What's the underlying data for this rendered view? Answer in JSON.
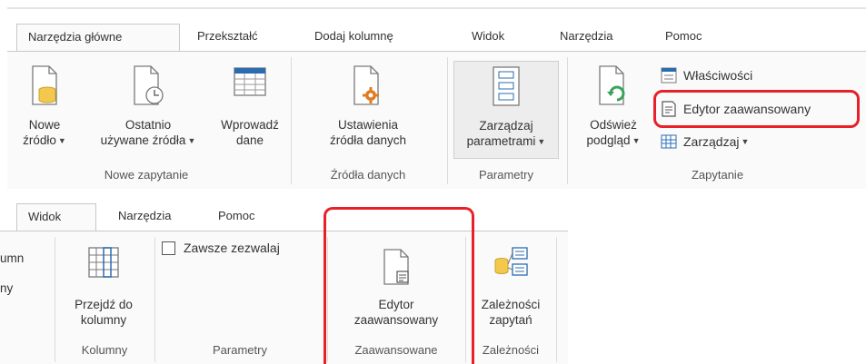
{
  "top": {
    "tabs": [
      "Narzędzia główne",
      "Przekształć",
      "Dodaj kolumnę",
      "Widok",
      "Narzędzia",
      "Pomoc"
    ],
    "buttons": {
      "new_source": [
        "Nowe",
        "źródło"
      ],
      "recent_sources": [
        "Ostatnio",
        "używane źródła"
      ],
      "enter_data": [
        "Wprowadź",
        "dane"
      ],
      "source_settings": [
        "Ustawienia",
        "źródła danych"
      ],
      "manage_params": [
        "Zarządzaj",
        "parametrami"
      ],
      "refresh_preview": [
        "Odśwież",
        "podgląd"
      ]
    },
    "small": {
      "properties": "Właściwości",
      "advanced_editor": "Edytor zaawansowany",
      "manage": "Zarządzaj"
    },
    "groups": [
      "Nowe zapytanie",
      "Źródła danych",
      "Parametry",
      "Zapytanie"
    ]
  },
  "bottom": {
    "tabs": [
      "Widok",
      "Narzędzia",
      "Pomoc"
    ],
    "clipped_left": [
      "umn",
      "ny"
    ],
    "checkbox_label": "Zawsze zezwalaj",
    "buttons": {
      "go_to_column": [
        "Przejdź do",
        "kolumny"
      ],
      "advanced_editor": [
        "Edytor",
        "zaawansowany"
      ],
      "query_deps": [
        "Zależności",
        "zapytań"
      ]
    },
    "groups": [
      "Kolumny",
      "Parametry",
      "Zaawansowane",
      "Zależności"
    ]
  },
  "colors": {
    "highlight": "#e8202a",
    "accent": "#2b6cb0",
    "cylinder": "#f2c94c",
    "gear": "#e07b1f",
    "refresh": "#3aa35a"
  },
  "icons": [
    "document-icon",
    "database-icon",
    "clock-icon",
    "table-icon",
    "gear-icon",
    "list-icon",
    "refresh-icon",
    "properties-icon",
    "advanced-editor-icon",
    "grid-icon",
    "checkbox-icon",
    "dependencies-icon",
    "dropdown-caret-icon"
  ]
}
